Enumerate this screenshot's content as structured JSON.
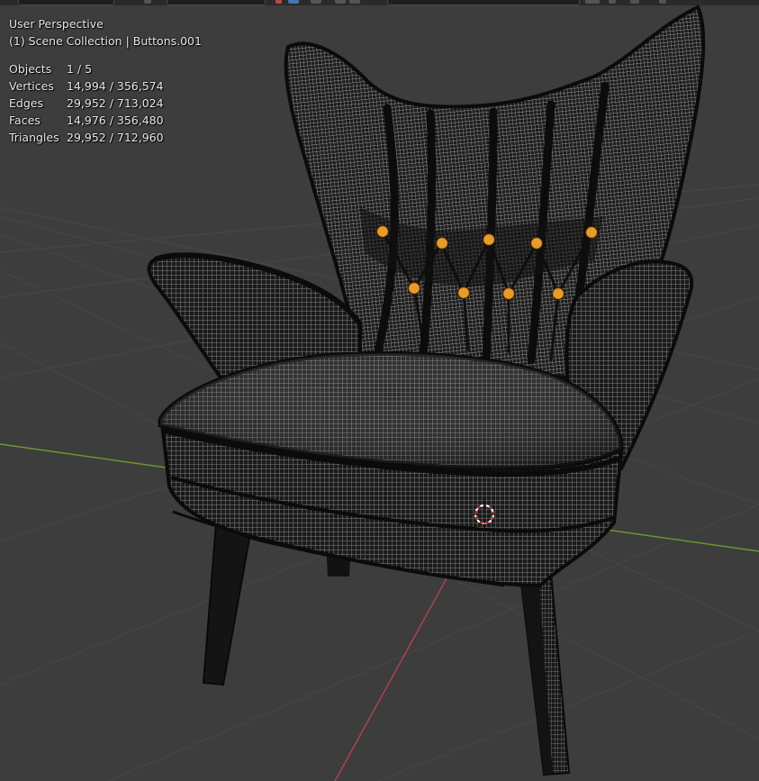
{
  "viewport": {
    "view_name": "User Perspective",
    "collection_line": "(1) Scene Collection | Buttons.001",
    "stats": [
      {
        "label": "Objects",
        "value": "1 / 5"
      },
      {
        "label": "Vertices",
        "value": "14,994 / 356,574"
      },
      {
        "label": "Edges",
        "value": "29,952 / 713,024"
      },
      {
        "label": "Faces",
        "value": "14,976 / 356,480"
      },
      {
        "label": "Triangles",
        "value": "29,952 / 712,960"
      }
    ]
  },
  "colors": {
    "background": "#3d3d3d",
    "grid_line": "#4a4a4a",
    "x_axis": "#b5424f",
    "y_axis": "#6e9a2e",
    "mesh_dark": "#111111",
    "mesh_light": "#9a9a9a",
    "selected_vertex": "#e89a2a",
    "cursor_red": "#d12a2a",
    "text": "#e8e8e8"
  },
  "icons": {
    "cursor": "3d-cursor-icon"
  }
}
